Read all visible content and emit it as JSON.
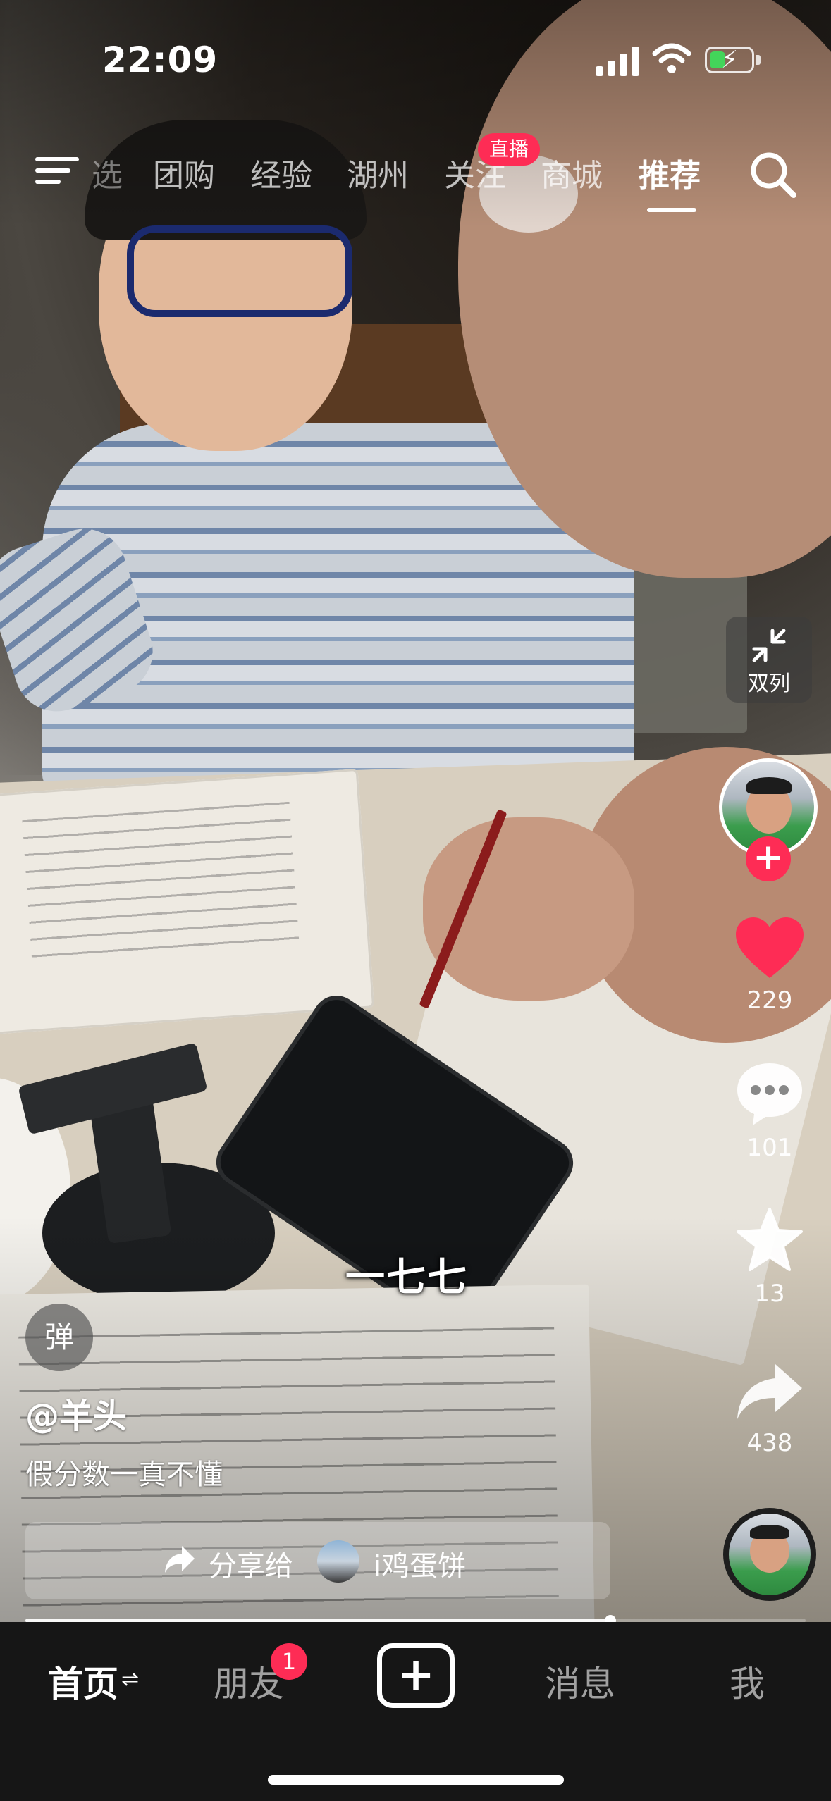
{
  "status_bar": {
    "time": "22:09",
    "battery_level": 0.4
  },
  "top_nav": {
    "partial_tab": "选",
    "tabs": [
      "团购",
      "经验",
      "湖州",
      "关注",
      "商城",
      "推荐"
    ],
    "active_tab": "推荐",
    "live_badge": "直播"
  },
  "right_rail": {
    "dual_column_label": "双列",
    "like_count": "229",
    "comment_count": "101",
    "favorite_count": "13",
    "share_count": "438"
  },
  "video": {
    "subtitle": "一七七",
    "danmaku_label": "弹",
    "author": "@羊头",
    "description": "假分数一真不懂",
    "progress": 0.75
  },
  "share_bar": {
    "text": "分享给",
    "friend": "i鸡蛋饼"
  },
  "tab_bar": {
    "home": "首页",
    "friends": "朋友",
    "friends_badge": "1",
    "messages": "消息",
    "me": "我"
  },
  "colors": {
    "accent": "#fe2c55",
    "battery": "#43d55a",
    "tab_bar_bg": "#161616"
  }
}
